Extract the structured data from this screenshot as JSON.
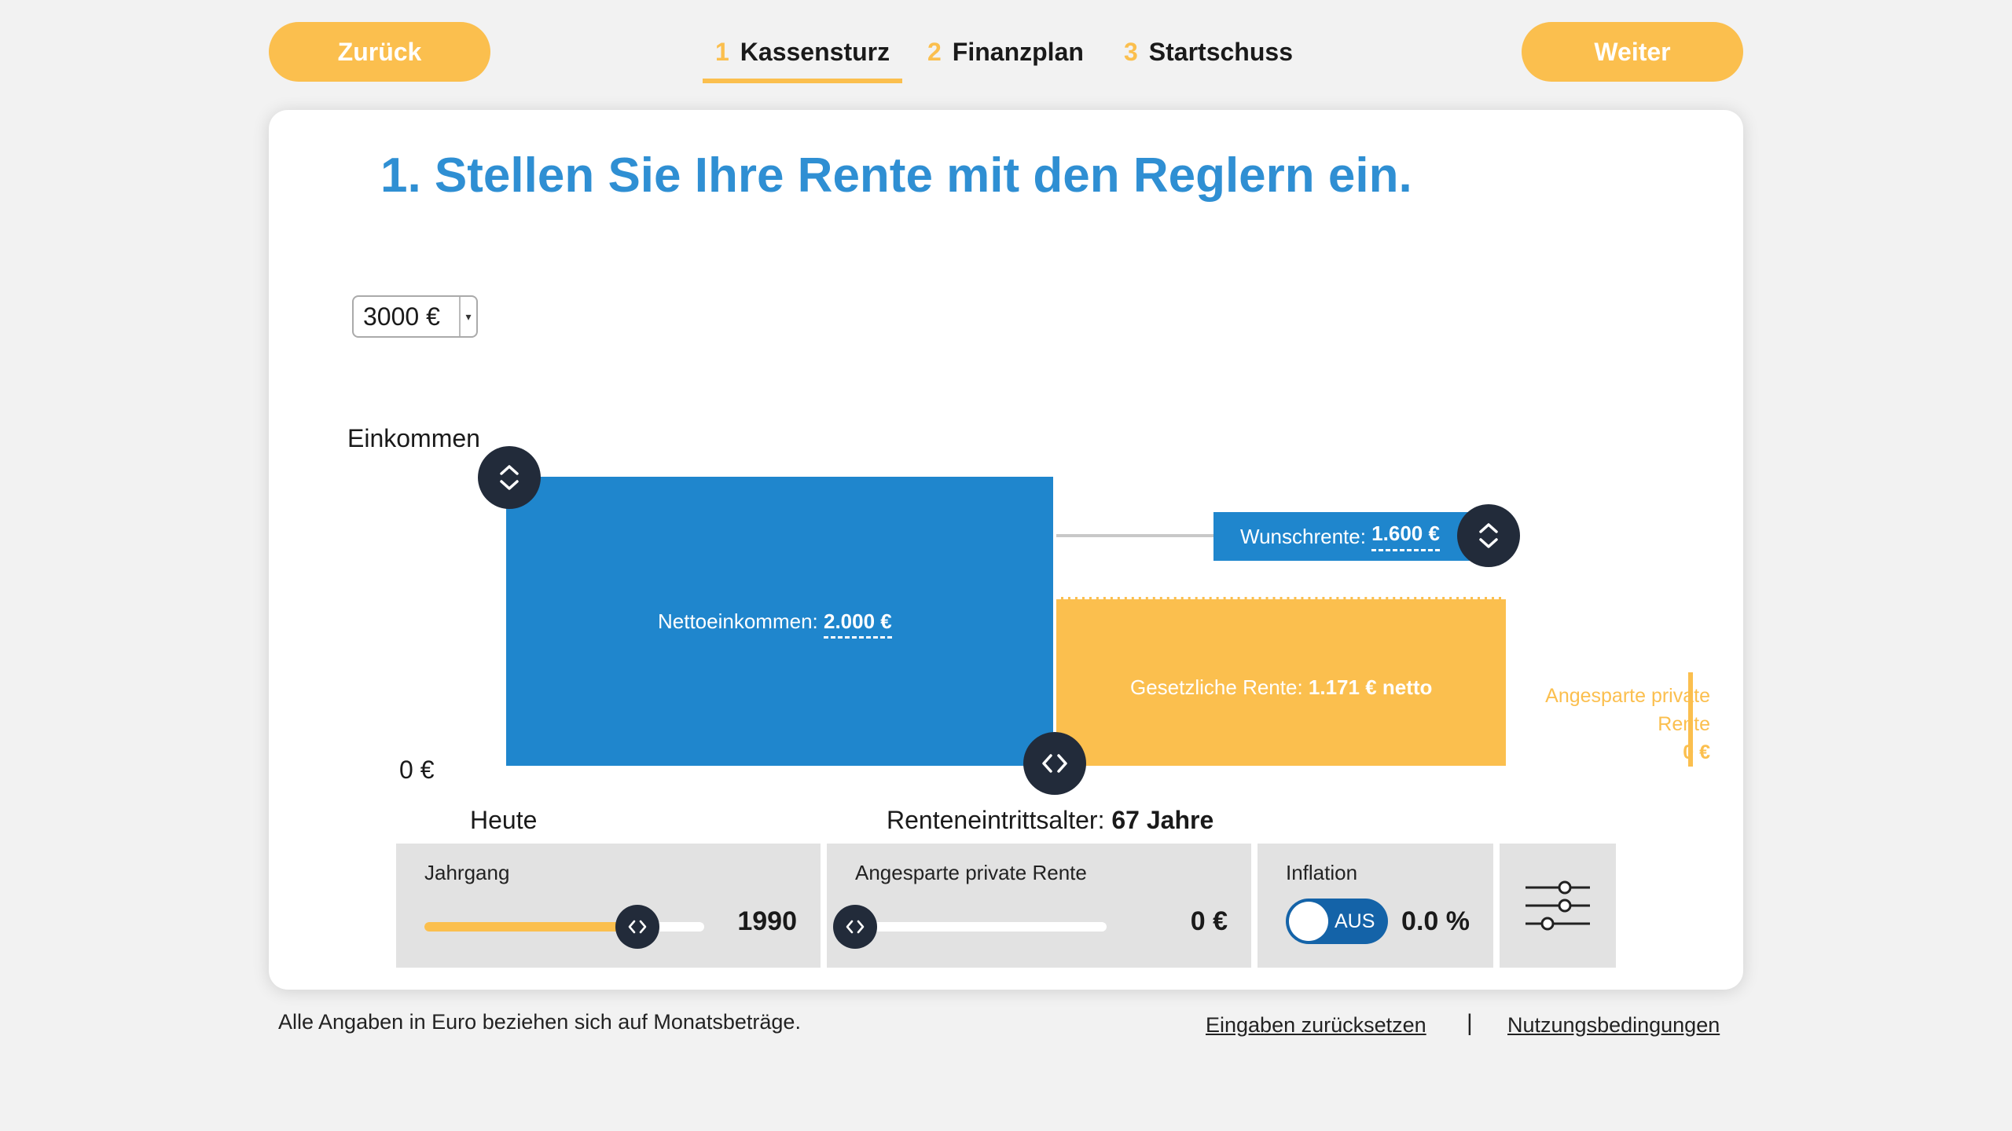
{
  "nav": {
    "back_label": "Zurück",
    "next_label": "Weiter",
    "steps": [
      {
        "num": "1",
        "label": "Kassensturz",
        "active": true
      },
      {
        "num": "2",
        "label": "Finanzplan",
        "active": false
      },
      {
        "num": "3",
        "label": "Startschuss",
        "active": false
      }
    ]
  },
  "card": {
    "headline": "1. Stellen Sie Ihre Rente mit den Reglern ein.",
    "income_select": {
      "value": "3000 €"
    },
    "y_label": "Einkommen",
    "zero_label": "0 €",
    "today_label": "Heute",
    "retirement_prefix": "Renteneintrittsalter:",
    "retirement_value": "67 Jahre"
  },
  "chart_data": {
    "type": "bar",
    "bars": [
      {
        "label": "Nettoeinkommen:",
        "value_label": "2.000 €",
        "value": 2000,
        "color": "#1f86cd"
      },
      {
        "label": "Gesetzliche Rente:",
        "value_label": "1.171 € netto",
        "value": 1171,
        "color": "#fbbf4e"
      }
    ],
    "wish": {
      "label": "Wunschrente:",
      "value_label": "1.600 €",
      "value": 1600
    },
    "private": {
      "line1": "Angesparte private",
      "line2": "Rente",
      "value_label": "0 €",
      "value": 0
    },
    "ylim_top": 2000
  },
  "controls": {
    "jahrgang": {
      "title": "Jahrgang",
      "value": "1990",
      "fill_fraction": 0.76
    },
    "private_pension": {
      "title": "Angesparte private Rente",
      "value": "0 €",
      "fill_fraction": 0
    },
    "inflation": {
      "title": "Inflation",
      "toggle_label": "AUS",
      "value": "0.0 %"
    }
  },
  "footer": {
    "note": "Alle Angaben in Euro beziehen sich auf Monatsbeträge.",
    "reset_label": "Eingaben zurücksetzen",
    "separator": "|",
    "terms_label": "Nutzungsbedingungen"
  },
  "colors": {
    "accent": "#fbbf4e",
    "primary": "#1f86cd",
    "headline": "#2f8fd3",
    "dark": "#222b3a"
  },
  "icons": [
    "chevron-up-down-icon",
    "chevron-left-right-icon",
    "sliders-icon"
  ]
}
